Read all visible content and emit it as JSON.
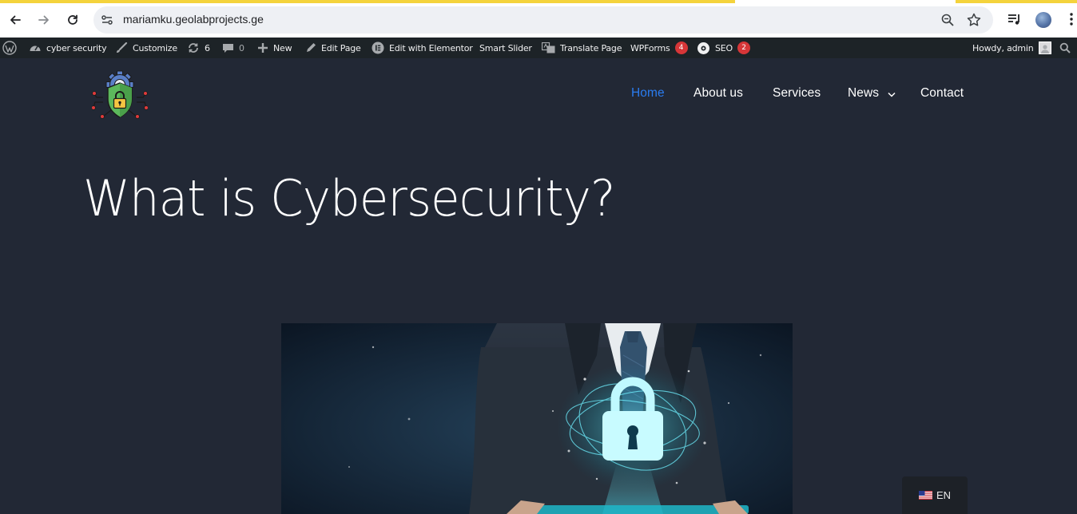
{
  "browser": {
    "url": "mariamku.geolabprojects.ge",
    "icons": [
      "back-icon",
      "forward-icon",
      "reload-icon",
      "site-info-icon",
      "zoom-icon",
      "star-icon",
      "media-control-icon",
      "profile-avatar",
      "more-menu-icon"
    ]
  },
  "admin_bar": {
    "site_name": "cyber security",
    "customize": "Customize",
    "updates_count": "6",
    "comments_count": "0",
    "new": "New",
    "edit_page": "Edit Page",
    "edit_elementor": "Edit with Elementor",
    "smart_slider": "Smart Slider",
    "translate_page": "Translate Page",
    "wpforms": "WPForms",
    "wpforms_badge": "4",
    "seo": "SEO",
    "seo_badge": "2",
    "howdy": "Howdy, admin"
  },
  "nav": {
    "items": [
      {
        "label": "Home",
        "active": true
      },
      {
        "label": "About us"
      },
      {
        "label": "Services"
      },
      {
        "label": "News"
      },
      {
        "label": "Contact"
      }
    ]
  },
  "page": {
    "title": "What is Cybersecurity?"
  },
  "language": {
    "code": "EN"
  },
  "colors": {
    "page_bg": "#222835",
    "admin_bar_bg": "#1d2327",
    "nav_active": "#2a7cf0",
    "badge": "#d63638"
  }
}
